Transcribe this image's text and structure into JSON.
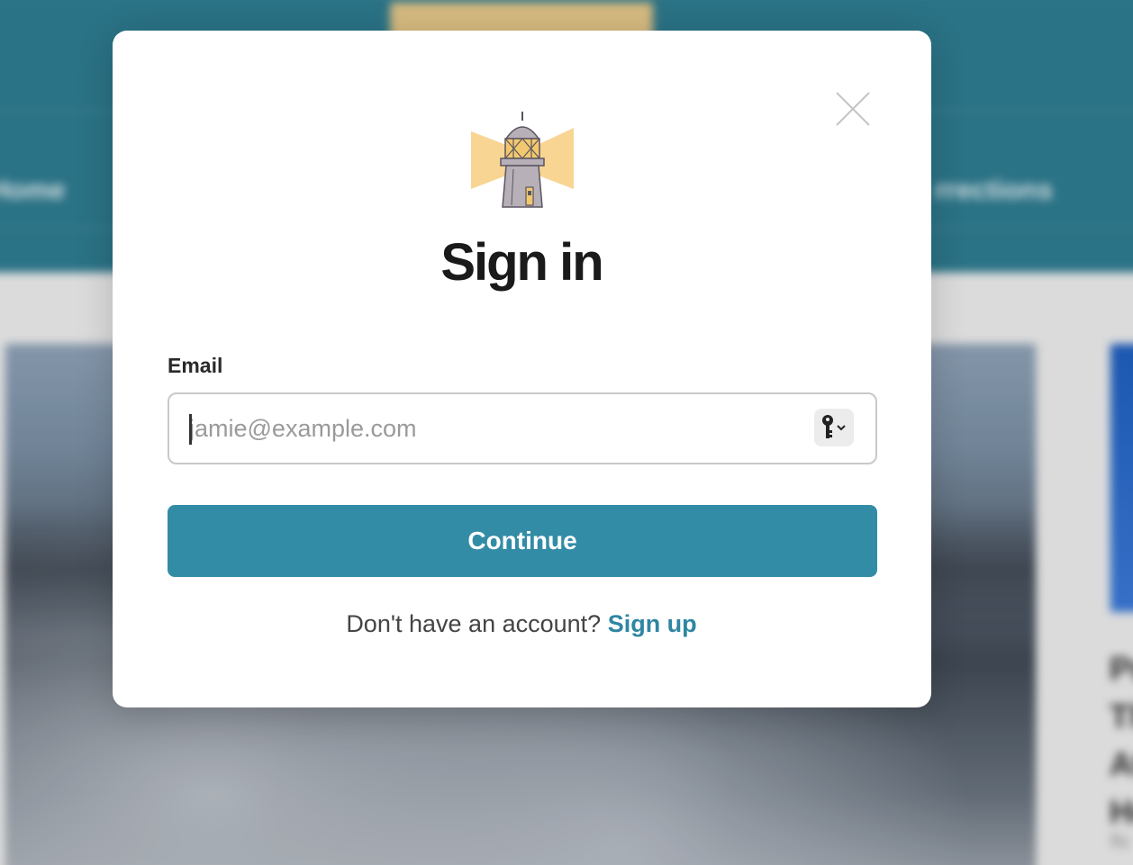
{
  "background": {
    "nav_left": "Home",
    "nav_right": "rrections",
    "side_title": "Pr\nTh\nAt\nHe",
    "side_byline": "By"
  },
  "modal": {
    "title": "Sign in",
    "email_label": "Email",
    "email_placeholder": "jamie@example.com",
    "continue_label": "Continue",
    "signup_prompt": "Don't have an account?",
    "signup_link": "Sign up"
  },
  "icons": {
    "logo": "lighthouse-icon",
    "close": "close-icon",
    "password_manager": "key-icon"
  },
  "colors": {
    "accent": "#338ca6",
    "link": "#2e86a2",
    "header_bg": "#2e7c91",
    "logo_beam": "#f8d592"
  }
}
